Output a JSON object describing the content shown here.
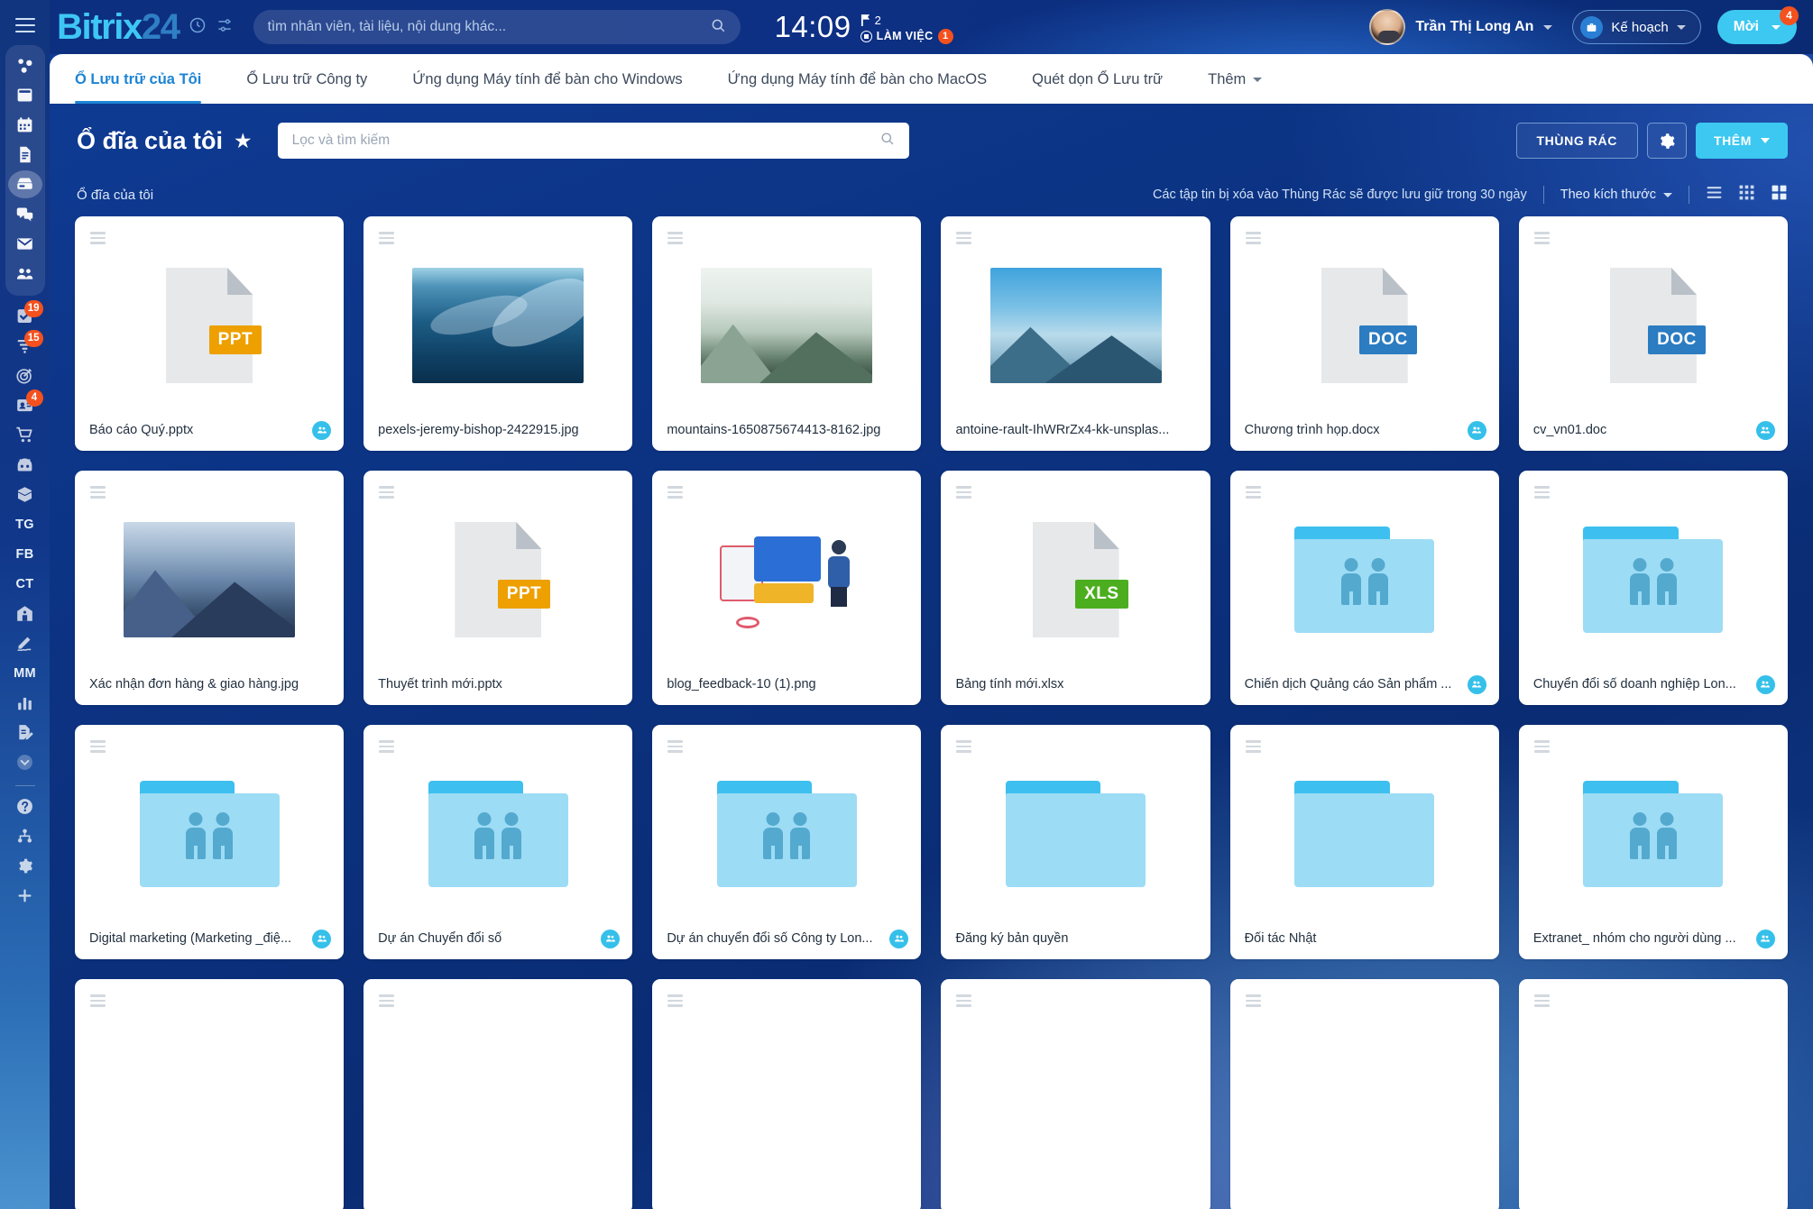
{
  "app": {
    "logo_primary": "Bitrix",
    "logo_secondary": "24",
    "clock": "14:09",
    "flag_count": "2",
    "status_label": "LÀM VIỆC",
    "status_count": "1",
    "user_name": "Trần Thị Long An",
    "plan_label": "Kế hoạch",
    "invite_label": "Mời",
    "invite_badge": "4"
  },
  "global_search": {
    "placeholder": "tìm nhân viên, tài liệu, nội dung khác..."
  },
  "tabs": [
    {
      "label": "Ổ Lưu trữ của Tôi",
      "active": true,
      "caret": false
    },
    {
      "label": "Ổ Lưu trữ Công ty",
      "active": false,
      "caret": false
    },
    {
      "label": "Ứng dụng Máy tính để bàn cho Windows",
      "active": false,
      "caret": false
    },
    {
      "label": "Ứng dụng Máy tính để bàn cho MacOS",
      "active": false,
      "caret": false
    },
    {
      "label": "Quét dọn Ổ Lưu trữ",
      "active": false,
      "caret": false
    },
    {
      "label": "Thêm",
      "active": false,
      "caret": true
    }
  ],
  "title_row": {
    "page_title": "Ổ đĩa của tôi",
    "filter_placeholder": "Lọc và tìm kiếm",
    "trash_label": "THÙNG RÁC",
    "add_label": "THÊM"
  },
  "info_row": {
    "breadcrumb": "Ổ đĩa của tôi",
    "retention_notice": "Các tập tin bị xóa vào Thùng Rác sẽ được lưu giữ trong 30 ngày",
    "sort_label": "Theo kích thước"
  },
  "colors": {
    "accent_cyan": "#3cc8f0",
    "brand_blue": "#1d84d4",
    "badge_orange": "#f4511e",
    "ppt": "#eda000",
    "doc": "#2b7cc1",
    "xls": "#4cae1e",
    "folder": "#3dc0ef"
  },
  "sidebar": {
    "top_items": [
      {
        "icon": "workspace-icon",
        "active": false
      },
      {
        "icon": "news-feed-icon",
        "active": false
      },
      {
        "icon": "calendar-icon",
        "active": false
      },
      {
        "icon": "documents-icon",
        "active": false
      },
      {
        "icon": "drive-icon",
        "active": true
      },
      {
        "icon": "chat-icon",
        "active": false
      },
      {
        "icon": "mail-icon",
        "active": false
      },
      {
        "icon": "employees-icon",
        "active": false
      }
    ],
    "mid_items": [
      {
        "icon": "tasks-icon",
        "badge": "19"
      },
      {
        "icon": "funnel-icon",
        "badge": "15"
      },
      {
        "icon": "target-icon",
        "badge": ""
      },
      {
        "icon": "contacts-icon",
        "badge": "4"
      },
      {
        "icon": "cart-icon",
        "badge": ""
      },
      {
        "icon": "bot-icon",
        "badge": ""
      },
      {
        "icon": "box-icon",
        "badge": ""
      }
    ],
    "letter_items": [
      {
        "label": "TG"
      },
      {
        "label": "FB"
      },
      {
        "label": "CT"
      }
    ],
    "mid_items2": [
      {
        "icon": "company-icon",
        "badge": ""
      },
      {
        "icon": "signature-icon",
        "badge": ""
      }
    ],
    "letter_items2": [
      {
        "label": "MM"
      }
    ],
    "bottom_items": [
      {
        "icon": "analytics-icon",
        "badge": ""
      },
      {
        "icon": "edit-doc-icon",
        "badge": ""
      },
      {
        "icon": "chevron-down-icon",
        "badge": ""
      }
    ],
    "footer_items": [
      {
        "icon": "help-icon"
      },
      {
        "icon": "sitemap-icon"
      },
      {
        "icon": "gear-icon"
      },
      {
        "icon": "plus-icon"
      }
    ]
  },
  "files": [
    {
      "name": "Báo cáo Quý.pptx",
      "kind": "doc",
      "tag": "PPT",
      "shared": true
    },
    {
      "name": "pexels-jeremy-bishop-2422915.jpg",
      "kind": "image",
      "thumb": "ocean",
      "shared": false
    },
    {
      "name": "mountains-1650875674413-8162.jpg",
      "kind": "image",
      "thumb": "mtn-light",
      "shared": false
    },
    {
      "name": "antoine-rault-IhWRrZx4-kk-unsplas...",
      "kind": "image",
      "thumb": "mtn-blue",
      "shared": false
    },
    {
      "name": "Chương trình họp.docx",
      "kind": "doc",
      "tag": "DOC",
      "shared": true
    },
    {
      "name": "cv_vn01.doc",
      "kind": "doc",
      "tag": "DOC",
      "shared": true
    },
    {
      "name": "Xác nhận đơn hàng & giao hàng.jpg",
      "kind": "image",
      "thumb": "mtn-dark",
      "shared": false
    },
    {
      "name": "Thuyết trình mới.pptx",
      "kind": "doc",
      "tag": "PPT",
      "shared": false
    },
    {
      "name": "blog_feedback-10 (1).png",
      "kind": "illustration",
      "shared": false
    },
    {
      "name": "Bảng tính mới.xlsx",
      "kind": "doc",
      "tag": "XLS",
      "shared": false
    },
    {
      "name": "Chiến dịch Quảng cáo Sản phẩm ...",
      "kind": "folder",
      "people": true,
      "shared": true
    },
    {
      "name": "Chuyển đổi số doanh nghiệp Lon...",
      "kind": "folder",
      "people": true,
      "shared": true
    },
    {
      "name": "Digital marketing (Marketing _điệ...",
      "kind": "folder",
      "people": true,
      "shared": true
    },
    {
      "name": "Dự án Chuyển đổi số",
      "kind": "folder",
      "people": true,
      "shared": true
    },
    {
      "name": "Dự án chuyển đổi số Công ty Lon...",
      "kind": "folder",
      "people": true,
      "shared": true
    },
    {
      "name": "Đăng ký bản quyền",
      "kind": "folder",
      "people": false,
      "shared": false
    },
    {
      "name": "Đối tác Nhật",
      "kind": "folder",
      "people": false,
      "shared": false
    },
    {
      "name": "Extranet_ nhóm cho người dùng ...",
      "kind": "folder",
      "people": true,
      "shared": true
    },
    {
      "name": "",
      "kind": "partial",
      "shared": false
    },
    {
      "name": "",
      "kind": "partial",
      "shared": false
    },
    {
      "name": "",
      "kind": "partial",
      "shared": false
    },
    {
      "name": "",
      "kind": "partial",
      "shared": false
    },
    {
      "name": "",
      "kind": "partial",
      "shared": false
    },
    {
      "name": "",
      "kind": "partial",
      "shared": false
    }
  ]
}
